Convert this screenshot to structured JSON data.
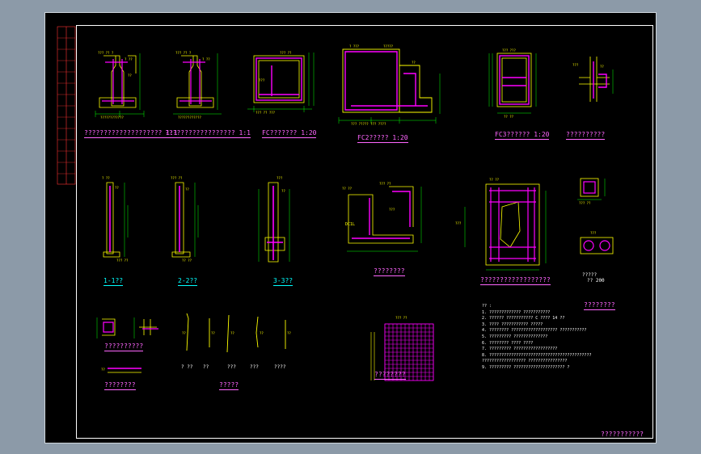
{
  "sheet_title": "???????????",
  "labels": {
    "v1": "????????????????????",
    "v1_scale": "1:1",
    "v2": "??????????????????",
    "v2_scale": "1:1",
    "v3": "FC???????",
    "v3_scale": "1:20",
    "v4": "FC2?????",
    "v4_scale": "1:20",
    "v5": "FC3??????",
    "v5_scale": "1:20",
    "v6": "??????????",
    "v7": "1-1??",
    "v8": "2-2??",
    "v9": "3-3??",
    "v10": "????????",
    "v11": "??????????????????",
    "v12": "??????????",
    "v13": "????????",
    "v14": "????????",
    "v15": "?????",
    "v16": "????????",
    "v16_sub1": "?????",
    "v16_sub2": "??  200",
    "v17": "???????",
    "rebar_tags": [
      "? ??",
      "??",
      "???",
      "???",
      "????"
    ],
    "dc_label": "DC1L"
  },
  "notes": {
    "heading": "?? :",
    "lines": [
      "1. ?????????????  ???????????",
      "2. ?????? ??????????? C  ???? 14 ??",
      "3. ???? ???????????   ?????",
      "4. ????????  ???????????????????  ???????????",
      "5. ?????????  ??????????????",
      "6. ????????  ???? ????",
      "7. ?????????  ??????????????????",
      "8. ??????????????????????????????????????????",
      "    ?????????????????? ????????????????",
      "9. ?????????   ?????????????????????   ?"
    ]
  },
  "colors": {
    "background": "#000000",
    "frame": "#ffffff",
    "rebar": "#ff00ff",
    "concrete": "#ffff00",
    "dimension": "#00ff00",
    "text": "#ff66ff",
    "annotation": "#00ffff"
  }
}
